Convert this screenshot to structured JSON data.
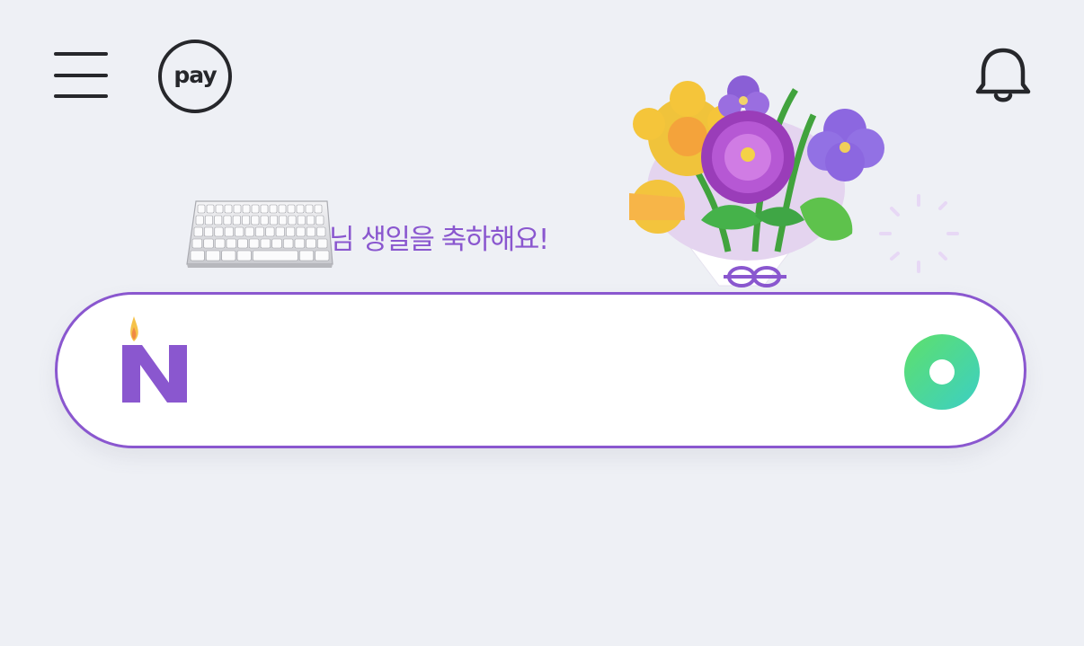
{
  "header": {
    "menu_icon": "hamburger-menu-icon",
    "pay_label": "pay",
    "bell_icon": "notification-bell-icon"
  },
  "greeting": {
    "emoji": "keyboard",
    "text": "님 생일을 축하해요!"
  },
  "illustration": "birthday-flower-bouquet",
  "search": {
    "value": "",
    "logo_icon": "naver-n-birthday-candle-icon",
    "action_icon": "green-circle-button-icon"
  },
  "colors": {
    "background": "#eef0f5",
    "accent_purple": "#8a57cf",
    "icon_dark": "#26272b",
    "green_start": "#5ee06b",
    "green_end": "#3ccfc4"
  }
}
